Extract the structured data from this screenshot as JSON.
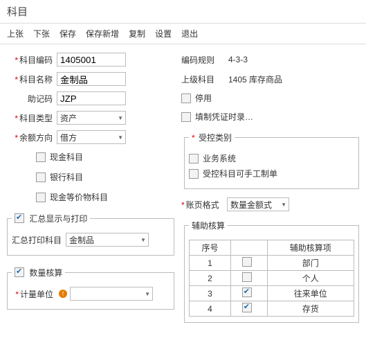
{
  "title": "科目",
  "toolbar": {
    "prev": "上张",
    "next": "下张",
    "save": "保存",
    "save_new": "保存新增",
    "copy": "复制",
    "settings": "设置",
    "exit": "退出"
  },
  "fields": {
    "code_label": "科目编码",
    "code_value": "1405001",
    "name_label": "科目名称",
    "name_value": "金制品",
    "mnemonic_label": "助记码",
    "mnemonic_value": "JZP",
    "type_label": "科目类型",
    "type_value": "资产",
    "balance_label": "余额方向",
    "balance_value": "借方"
  },
  "info": {
    "rule_label": "编码规则",
    "rule_value": "4-3-3",
    "parent_label": "上级科目",
    "parent_value": "1405 库存商品",
    "disable": "停用",
    "voucher": "填制凭证时录…"
  },
  "checks": {
    "cash": "现金科目",
    "bank": "银行科目",
    "cash_equiv": "现金等价物科目"
  },
  "controlled": {
    "legend": "受控类别",
    "biz": "业务系统",
    "manual": "受控科目可手工制单"
  },
  "summary": {
    "legend": "汇总显示与打印",
    "print_label": "汇总打印科目",
    "print_value": "金制品"
  },
  "ledger": {
    "label": "账页格式",
    "value": "数量金额式"
  },
  "qty": {
    "legend": "数量核算",
    "unit_label": "计量单位"
  },
  "aux": {
    "legend": "辅助核算",
    "header_seq": "序号",
    "header_item": "辅助核算项",
    "rows": [
      {
        "seq": "1",
        "checked": false,
        "item": "部门"
      },
      {
        "seq": "2",
        "checked": false,
        "item": "个人"
      },
      {
        "seq": "3",
        "checked": true,
        "item": "往来单位"
      },
      {
        "seq": "4",
        "checked": true,
        "item": "存货"
      }
    ]
  }
}
